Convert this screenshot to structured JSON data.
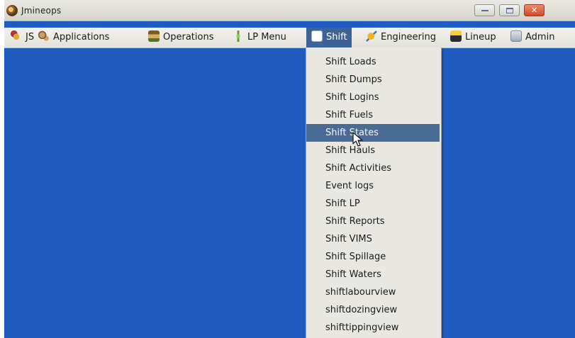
{
  "window": {
    "title": "Jmineops",
    "controls": {
      "minimize": "minimize",
      "maximize": "maximize",
      "close": "✕"
    }
  },
  "menubar": {
    "items": [
      {
        "label": "JS",
        "icon": "js-icon"
      },
      {
        "label": "Applications",
        "icon": "applications-icon"
      },
      {
        "label": "Operations",
        "icon": "operations-icon"
      },
      {
        "label": "LP Menu",
        "icon": "lp-menu-icon"
      },
      {
        "label": "Shift",
        "icon": "shift-icon"
      },
      {
        "label": "Engineering",
        "icon": "engineering-icon"
      },
      {
        "label": "Lineup",
        "icon": "lineup-icon"
      },
      {
        "label": "Admin",
        "icon": "admin-icon"
      }
    ],
    "active": "Shift"
  },
  "dropdown": {
    "items": [
      "Shift Loads",
      "Shift Dumps",
      "Shift Logins",
      "Shift Fuels",
      "Shift States",
      "Shift Hauls",
      "Shift Activities",
      "Event logs",
      "Shift LP",
      "Shift Reports",
      "Shift VIMS",
      "Shift Spillage",
      "Shift Waters",
      "shiftlabourview",
      "shiftdozingview",
      "shifttippingview"
    ],
    "highlighted": "Shift States"
  },
  "colors": {
    "desktop": "#1f5cc0",
    "menu_active": "#3d6396",
    "item_highlight": "#4a6c94",
    "dropdown_bg": "#e8e7e1"
  }
}
